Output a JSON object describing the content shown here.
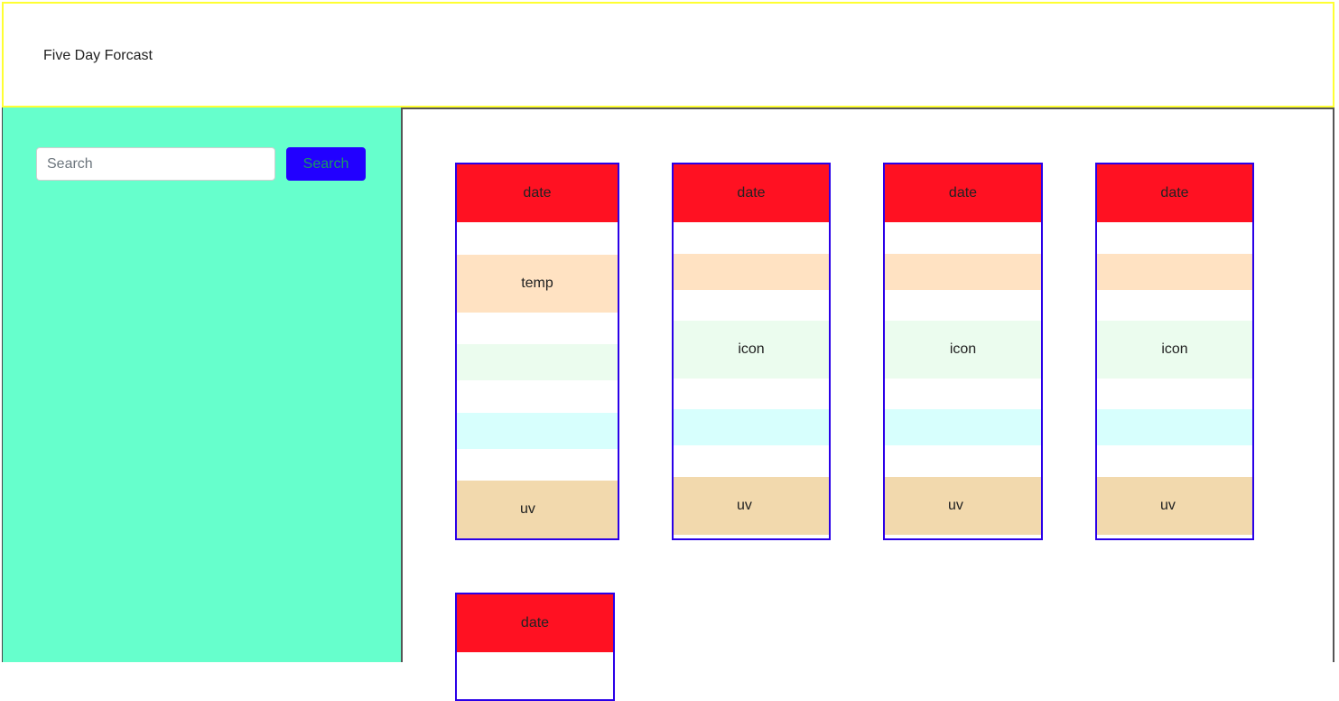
{
  "header": {
    "title": "Five Day Forcast"
  },
  "search": {
    "placeholder": "Search",
    "value": "",
    "button_label": "Search"
  },
  "colors": {
    "header_border": "#ffff33",
    "sidebar_bg": "#66ffcc",
    "search_button_bg": "#2200ff",
    "search_button_text": "#1a9a62",
    "card_border": "#2a00e8",
    "date_bg": "#ff1122",
    "temp_bg": "#ffe2c2",
    "icon_bg": "#ebfcee",
    "wind_bg": "#d7fffd",
    "uv_bg": "#f2d9ad"
  },
  "cards": [
    {
      "date": "date",
      "temp": "temp",
      "icon": "",
      "uv": "uv"
    },
    {
      "date": "date",
      "temp": "",
      "icon": "icon",
      "uv": "uv"
    },
    {
      "date": "date",
      "temp": "",
      "icon": "icon",
      "uv": "uv"
    },
    {
      "date": "date",
      "temp": "",
      "icon": "icon",
      "uv": "uv"
    },
    {
      "date": "date"
    }
  ]
}
